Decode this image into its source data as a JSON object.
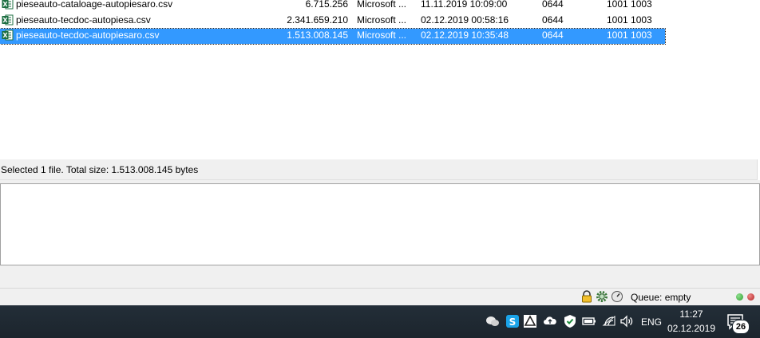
{
  "file_list": {
    "rows": [
      {
        "name": "pieseauto-cataloage-autopiesaro.csv",
        "size": "6.715.256",
        "type": "Microsoft ...",
        "date": "11.11.2019 10:09:00",
        "permissions": "0644",
        "owner": "1001 1003",
        "selected": false
      },
      {
        "name": "pieseauto-tecdoc-autopiesa.csv",
        "size": "2.341.659.210",
        "type": "Microsoft ...",
        "date": "02.12.2019 00:58:16",
        "permissions": "0644",
        "owner": "1001 1003",
        "selected": false
      },
      {
        "name": "pieseauto-tecdoc-autopiesaro.csv",
        "size": "1.513.008.145",
        "type": "Microsoft ...",
        "date": "02.12.2019 10:35:48",
        "permissions": "0644",
        "owner": "1001 1003",
        "selected": true
      }
    ]
  },
  "status_bar": {
    "text": "Selected 1 file. Total size: 1.513.008.145 bytes"
  },
  "bottom_status": {
    "queue_label": "Queue: empty",
    "icons": [
      "lock-icon",
      "gear-icon",
      "speed-limit-icon"
    ],
    "indicators": [
      {
        "name": "transfer-idle-indicator",
        "color": "#2e9e2e"
      },
      {
        "name": "transfer-busy-indicator",
        "color": "#b02020"
      }
    ]
  },
  "taskbar": {
    "tray_icons": [
      "wechat-icon",
      "skype-icon",
      "google-drive-icon",
      "onedrive-icon",
      "defender-icon",
      "battery-icon",
      "wifi-icon",
      "volume-icon"
    ],
    "language": "ENG",
    "time": "11:27",
    "date": "02.12.2019",
    "notification_count": "26"
  },
  "colors": {
    "selection": "#3399ff",
    "taskbar": "#1f2a33",
    "panel": "#f0f0f0"
  }
}
